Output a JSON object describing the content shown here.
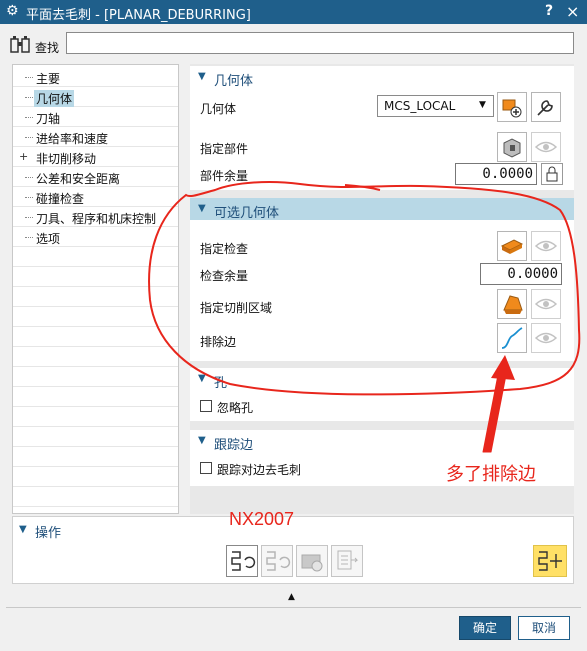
{
  "window": {
    "title": "平面去毛刺 - [PLANAR_DEBURRING]",
    "help": "?",
    "close": "×"
  },
  "search": {
    "label": "查找",
    "value": ""
  },
  "nav": {
    "items": [
      {
        "label": "主要",
        "expandable": false,
        "selected": false
      },
      {
        "label": "几何体",
        "expandable": false,
        "selected": true
      },
      {
        "label": "刀轴",
        "expandable": false,
        "selected": false
      },
      {
        "label": "进给率和速度",
        "expandable": false,
        "selected": false
      },
      {
        "label": "非切削移动",
        "expandable": true,
        "selected": false
      },
      {
        "label": "公差和安全距离",
        "expandable": false,
        "selected": false
      },
      {
        "label": "碰撞检查",
        "expandable": false,
        "selected": false
      },
      {
        "label": "刀具、程序和机床控制",
        "expandable": false,
        "selected": false
      },
      {
        "label": "选项",
        "expandable": false,
        "selected": false
      }
    ],
    "expand_symbol": "+"
  },
  "geometry": {
    "title": "几何体",
    "geometry_label": "几何体",
    "geometry_value": "MCS_LOCAL",
    "specify_part_label": "指定部件",
    "part_stock_label": "部件余量",
    "part_stock_value": "0.0000"
  },
  "optional_geometry": {
    "title": "可选几何体",
    "specify_check_label": "指定检查",
    "check_stock_label": "检查余量",
    "check_stock_value": "0.0000",
    "specify_cut_area_label": "指定切削区域",
    "exclude_edges_label": "排除边"
  },
  "holes": {
    "title": "孔",
    "ignore_holes_label": "忽略孔"
  },
  "trace_edge": {
    "title": "跟踪边",
    "trace_deburr_label": "跟踪对边去毛刺"
  },
  "operations": {
    "title": "操作"
  },
  "footer": {
    "ok": "确定",
    "cancel": "取消",
    "more_symbol": "▲"
  },
  "annotations": {
    "version_text": "NX2007",
    "note_text": "多了排除边",
    "color": "#e8261c"
  },
  "colors": {
    "accent": "#1f5f8b",
    "section_header": "#b8d8e6",
    "orange": "#f08a1c"
  }
}
